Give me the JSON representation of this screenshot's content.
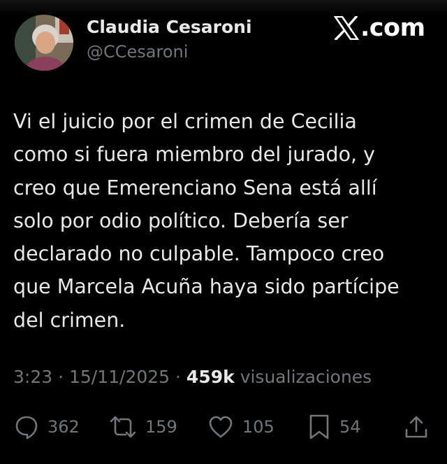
{
  "author": {
    "display_name": "Claudia Cesaroni",
    "handle": "@CCesaroni"
  },
  "brand": {
    "icon": "x-logo-icon",
    "text": ".com"
  },
  "tweet": {
    "text": "Vi el juicio por el crimen de Cecilia\ncomo si fuera miembro del jurado, y\ncreo que Emerenciano Sena está allí\nsolo por odio  político. Debería ser\ndeclarado no culpable. Tampoco creo\nque Marcela Acuña haya sido partícipe\ndel crimen.",
    "time": "3:23",
    "separator": " · ",
    "date": "15/11/2025",
    "views_count": "459k",
    "views_label": "visualizaciones"
  },
  "actions": {
    "reply": {
      "icon": "reply-icon",
      "count": "362"
    },
    "repost": {
      "icon": "repost-icon",
      "count": "159"
    },
    "like": {
      "icon": "heart-icon",
      "count": "105"
    },
    "bookmark": {
      "icon": "bookmark-icon",
      "count": "54"
    },
    "share": {
      "icon": "share-icon"
    }
  },
  "colors": {
    "background": "#000000",
    "primary_text": "#e7e9ea",
    "secondary_text": "#71767b"
  }
}
